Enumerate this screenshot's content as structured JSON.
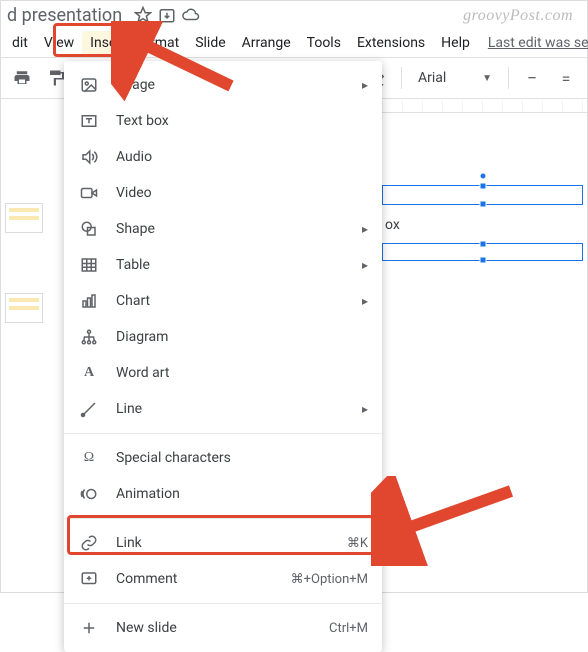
{
  "watermark": "groovyPost.com",
  "header": {
    "title": "d presentation"
  },
  "menubar": {
    "items": [
      "dit",
      "View",
      "Insert",
      "ormat",
      "Slide",
      "Arrange",
      "Tools",
      "Extensions",
      "Help"
    ],
    "last_edit": "Last edit was sec"
  },
  "toolbar": {
    "font": "Arial",
    "minus": "−",
    "eq": "="
  },
  "dropdown": {
    "items": [
      {
        "icon": "image-icon",
        "label": "Image",
        "submenu": true,
        "shortcut": ""
      },
      {
        "icon": "textbox-icon",
        "label": "Text box",
        "submenu": false,
        "shortcut": ""
      },
      {
        "icon": "audio-icon",
        "label": "Audio",
        "submenu": false,
        "shortcut": ""
      },
      {
        "icon": "video-icon",
        "label": "Video",
        "submenu": false,
        "shortcut": ""
      },
      {
        "icon": "shape-icon",
        "label": "Shape",
        "submenu": true,
        "shortcut": ""
      },
      {
        "icon": "table-icon",
        "label": "Table",
        "submenu": true,
        "shortcut": ""
      },
      {
        "icon": "chart-icon",
        "label": "Chart",
        "submenu": true,
        "shortcut": ""
      },
      {
        "icon": "diagram-icon",
        "label": "Diagram",
        "submenu": false,
        "shortcut": ""
      },
      {
        "icon": "wordart-icon",
        "label": "Word art",
        "submenu": false,
        "shortcut": ""
      },
      {
        "icon": "line-icon",
        "label": "Line",
        "submenu": true,
        "shortcut": ""
      }
    ],
    "items2": [
      {
        "icon": "omega-icon",
        "label": "Special characters",
        "submenu": false,
        "shortcut": ""
      },
      {
        "icon": "motion-icon",
        "label": "Animation",
        "submenu": false,
        "shortcut": ""
      }
    ],
    "items3": [
      {
        "icon": "link-icon",
        "label": "Link",
        "submenu": false,
        "shortcut": "⌘K"
      },
      {
        "icon": "comment-icon",
        "label": "Comment",
        "submenu": false,
        "shortcut": "⌘+Option+M"
      }
    ],
    "items4": [
      {
        "icon": "plus-icon",
        "label": "New slide",
        "submenu": false,
        "shortcut": "Ctrl+M"
      }
    ]
  },
  "canvas": {
    "hint": "ox"
  }
}
